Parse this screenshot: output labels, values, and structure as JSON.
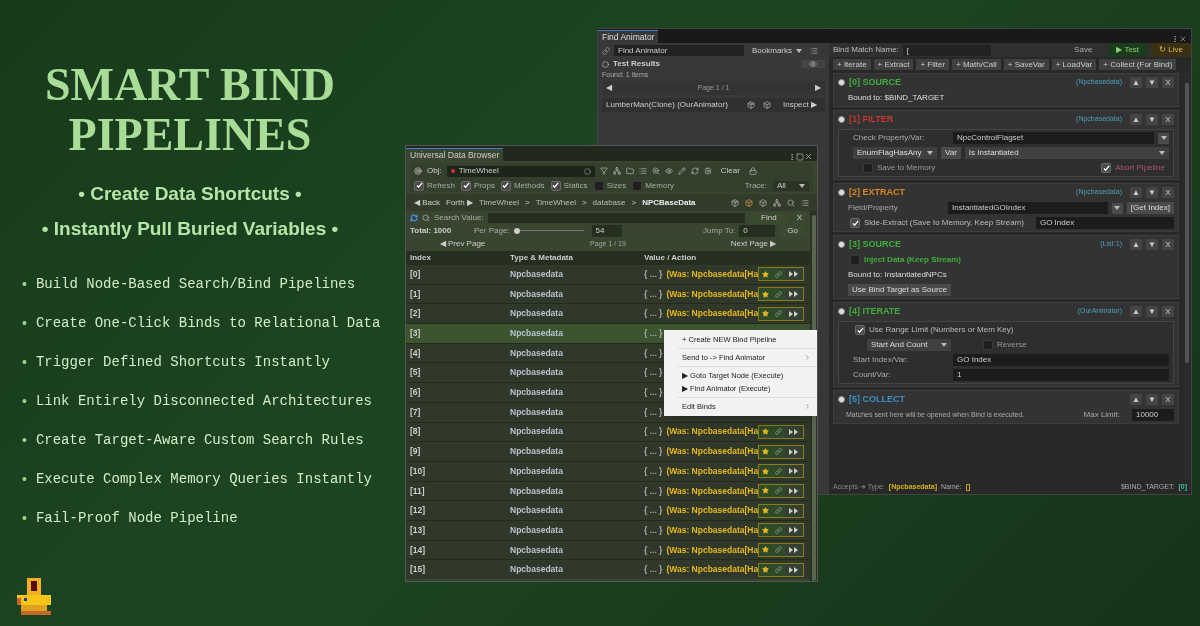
{
  "promo": {
    "title": "SMART BIND PIPELINES",
    "taglines": [
      "• Create Data Shortcuts •",
      "• Instantly Pull Buried Variables •"
    ],
    "features": [
      {
        "bullet": "•",
        "text": "Build Node-Based Search/Bind Pipelines"
      },
      {
        "bullet": "•",
        "text": "Create One-Click Binds to Relational Data"
      },
      {
        "bullet": "•",
        "text": "Trigger Defined Shortcuts Instantly"
      },
      {
        "bullet": "•",
        "text": "Link Entirely Disconnected Architectures"
      },
      {
        "bullet": "•",
        "text": "Create Target-Aware Custom Search Rules"
      },
      {
        "bullet": "•",
        "text": "Execute Complex Memory Queries Instantly"
      },
      {
        "bullet": "•",
        "text": "Fail-Proof Node Pipeline"
      }
    ]
  },
  "find_animator": {
    "tab": "Find Animator",
    "search": {
      "value": "Find Animator"
    },
    "bookmarks": "Bookmarks",
    "results_title": "Test Results",
    "found": "Found: 1 items",
    "pager": {
      "prev": "◀",
      "page": "Page 1 / 1",
      "next": "▶"
    },
    "results": [
      {
        "label": "LumberMan(Clone) (OurAnimator)",
        "inspect": "Inspect ▶"
      }
    ],
    "bind_name": {
      "label": "Bind Match Name:",
      "value": "["
    },
    "save": "Save",
    "test": "▶ Test",
    "live": "↻ Live",
    "add_buttons": [
      "+ Iterate",
      "+ Extract",
      "+ Filter",
      "+ Math/Call",
      "+ SaveVar",
      "+ LoadVar",
      "+ Collect (For Bind)"
    ],
    "nodes": [
      {
        "title": "[0] SOURCE",
        "color": "#3fae3a",
        "type_tag": "(Npcbasedata)",
        "controls": [
          "▲",
          "▼",
          "X"
        ],
        "boxed": false,
        "body": [
          {
            "kind": "text",
            "text": "Bound to: $BIND_TARGET"
          }
        ]
      },
      {
        "title": "[1] FILTER",
        "color": "#c43a2e",
        "type_tag": "(Npcbasedata)",
        "controls": [
          "▲",
          "▼",
          "X"
        ],
        "boxed": true,
        "body": [
          {
            "kind": "field",
            "label": "Check Property/Var:",
            "value": "NpcControlFlagset",
            "dropdown": true
          },
          {
            "kind": "selects",
            "items": [
              {
                "label": "EnumFlagHasAny",
                "dropdown": true
              },
              {
                "label": "Var",
                "dropdown": false
              },
              {
                "label": "Is Instantiated",
                "dropdown": true
              }
            ]
          },
          {
            "kind": "checks",
            "items": [
              {
                "label": "Save to Memory",
                "checked": false
              },
              {
                "label": "Abort Pipeline",
                "checked": true
              }
            ]
          }
        ]
      },
      {
        "title": "[2] EXTRACT",
        "color": "#d9891c",
        "type_tag": "(Npcbasedata)",
        "controls": [
          "▲",
          "▼",
          "X"
        ],
        "boxed": false,
        "body": [
          {
            "kind": "field",
            "label": "Field/Property",
            "value": "InstantiatedGOIndex",
            "dropdown": true,
            "button": "[Get Index]"
          },
          {
            "kind": "check",
            "label": "Side-Extract (Save to Memory, Keep Stream)",
            "checked": true,
            "value": "GO Index"
          }
        ]
      },
      {
        "title": "[3] SOURCE",
        "color": "#3fae3a",
        "type_tag": "(List`1)",
        "controls": [
          "▲",
          "▼",
          "X"
        ],
        "boxed": false,
        "body": [
          {
            "kind": "check",
            "label": "Inject Data (Keep Stream)",
            "checked": false,
            "accent": true
          },
          {
            "kind": "text",
            "text": "Bound to: InstantiatedNPCs"
          },
          {
            "kind": "button",
            "label": "Use Bind Target as Source"
          }
        ]
      },
      {
        "title": "[4] ITERATE",
        "color": "#3fae3a",
        "type_tag": "(OurAnimator)",
        "controls": [
          "▲",
          "▼",
          "X"
        ],
        "boxed": true,
        "body": [
          {
            "kind": "check",
            "label": "Use Range Limit (Numbers or Mem Key)",
            "checked": true
          },
          {
            "kind": "select_check",
            "select": "Start And Count",
            "label": "Reverse",
            "checked": false
          },
          {
            "kind": "field",
            "label": "Start Index/Var:",
            "value": "GO Index",
            "dropdown": false
          },
          {
            "kind": "field",
            "label": "Count/Var:",
            "value": "1",
            "dropdown": false
          }
        ]
      },
      {
        "title": "[5] COLLECT",
        "color": "#3a8fc4",
        "controls": [
          "▲",
          "▼",
          "X"
        ],
        "boxed": false,
        "body": [
          {
            "kind": "note_field",
            "note": "Matches sent here will be opened when Bind is executed.",
            "label": "Max Limit:",
            "value": "10000"
          }
        ]
      }
    ],
    "footer": {
      "accepts": "Accepts ➜ Type:",
      "type": "[Npcbasedata]",
      "name_label": "Name:",
      "name": "[]",
      "target_label": "$BIND_TARGET:",
      "target": "[0]"
    }
  },
  "data_browser": {
    "title": "Universal Data Browser",
    "obj_label": "Obj:",
    "obj_value": "TimeWheel",
    "clear": "Clear",
    "options": [
      {
        "label": "Refresh",
        "checked": true
      },
      {
        "label": "Props",
        "checked": true
      },
      {
        "label": "Methods",
        "checked": true
      },
      {
        "label": "Statics",
        "checked": true
      },
      {
        "label": "Sizes",
        "checked": false
      },
      {
        "label": "Memory",
        "checked": false
      }
    ],
    "trace_label": "Trace:",
    "trace_value": "All",
    "back": "◀ Back",
    "forth": "Forth ▶",
    "breadcrumbs": [
      {
        "label": "TimeWheel",
        "current": false
      },
      {
        "label": "TimeWheel",
        "current": false
      },
      {
        "label": "database",
        "current": false
      },
      {
        "label": "NPCBaseData",
        "current": true
      }
    ],
    "separator": ">",
    "search_label": "Search Value:",
    "find": "Find",
    "clear_search": "X",
    "total": "Total: 1000",
    "per_page_label": "Per Page:",
    "per_page": {
      "level": 0.05,
      "value": "54"
    },
    "jump_label": "Jump To:",
    "jump_value": "0",
    "go": "Go",
    "prev_page": "◀ Prev Page",
    "page": "Page 1 / 19",
    "next_page": "Next Page ▶",
    "columns": [
      "Index",
      "Type & Metadata",
      "Value / Action"
    ],
    "rows": [
      {
        "index": "[0]",
        "type": "Npcbasedata",
        "value": "{ ... }",
        "note": "(Was: Npcbasedata[Ha",
        "selected": false
      },
      {
        "index": "[1]",
        "type": "Npcbasedata",
        "value": "{ ... }",
        "note": "(Was: Npcbasedata[Ha",
        "selected": false
      },
      {
        "index": "[2]",
        "type": "Npcbasedata",
        "value": "{ ... }",
        "note": "(Was: Npcbasedata[Ha",
        "selected": false
      },
      {
        "index": "[3]",
        "type": "Npcbasedata",
        "value": "{ ... }",
        "selected": true
      },
      {
        "index": "[4]",
        "type": "Npcbasedata",
        "value": "{ ... }",
        "selected": false
      },
      {
        "index": "[5]",
        "type": "Npcbasedata",
        "value": "{ ... }",
        "selected": false
      },
      {
        "index": "[6]",
        "type": "Npcbasedata",
        "value": "{ ... }",
        "selected": false
      },
      {
        "index": "[7]",
        "type": "Npcbasedata",
        "value": "{ ... }",
        "selected": false
      },
      {
        "index": "[8]",
        "type": "Npcbasedata",
        "value": "{ ... }",
        "note": "(Was: Npcbasedata[Ha",
        "selected": false
      },
      {
        "index": "[9]",
        "type": "Npcbasedata",
        "value": "{ ... }",
        "note": "(Was: Npcbasedata[Ha",
        "selected": false
      },
      {
        "index": "[10]",
        "type": "Npcbasedata",
        "value": "{ ... }",
        "note": "(Was: Npcbasedata[Ha",
        "selected": false
      },
      {
        "index": "[11]",
        "type": "Npcbasedata",
        "value": "{ ... }",
        "note": "(Was: Npcbasedata[Ha",
        "selected": false
      },
      {
        "index": "[12]",
        "type": "Npcbasedata",
        "value": "{ ... }",
        "note": "(Was: Npcbasedata[Ha",
        "selected": false
      },
      {
        "index": "[13]",
        "type": "Npcbasedata",
        "value": "{ ... }",
        "note": "(Was: Npcbasedata[Ha",
        "selected": false
      },
      {
        "index": "[14]",
        "type": "Npcbasedata",
        "value": "{ ... }",
        "note": "(Was: Npcbasedata[Ha",
        "selected": false
      },
      {
        "index": "[15]",
        "type": "Npcbasedata",
        "value": "{ ... }",
        "note": "(Was: Npcbasedata[Ha",
        "selected": false
      }
    ],
    "context_menu": [
      {
        "kind": "item",
        "label": "+ Create NEW Bind Pipeline",
        "submenu": false
      },
      {
        "kind": "separator"
      },
      {
        "kind": "item",
        "label": "Send to -> Find Animator",
        "submenu": true
      },
      {
        "kind": "separator"
      },
      {
        "kind": "item",
        "label": "▶ Goto Target Node (Execute)",
        "submenu": false
      },
      {
        "kind": "item",
        "label": "▶ Find Animator (Execute)",
        "submenu": false
      },
      {
        "kind": "separator"
      },
      {
        "kind": "item",
        "label": "Edit Binds",
        "submenu": true
      }
    ]
  }
}
